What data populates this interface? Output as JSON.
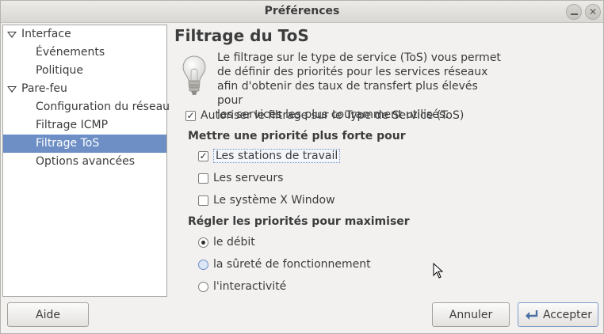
{
  "window": {
    "title": "Préférences"
  },
  "sidebar": {
    "items": [
      {
        "label": "Interface",
        "level": 0,
        "expanded": true
      },
      {
        "label": "Événements",
        "level": 1
      },
      {
        "label": "Politique",
        "level": 1
      },
      {
        "label": "Pare-feu",
        "level": 0,
        "expanded": true
      },
      {
        "label": "Configuration du réseau",
        "level": 1
      },
      {
        "label": "Filtrage ICMP",
        "level": 1
      },
      {
        "label": "Filtrage ToS",
        "level": 1,
        "selected": true
      },
      {
        "label": "Options avancées",
        "level": 1
      }
    ]
  },
  "main": {
    "title": "Filtrage du ToS",
    "icon": "lightbulb-icon",
    "description_lines": [
      "Le filtrage sur le type de service (ToS) vous permet",
      "de définir des priorités pour les services réseaux",
      "afin d'obtenir des taux de transfert plus élevés pour",
      "les services les plus couramment utilisés."
    ],
    "enable_checkbox": {
      "label": "Autoriser le filtrage sur le Type de Service (ToS)",
      "checked": true
    },
    "priority_section": {
      "title": "Mettre une priorité plus forte pour",
      "options": [
        {
          "label": "Les stations de travail",
          "checked": true
        },
        {
          "label": "Les serveurs",
          "checked": false
        },
        {
          "label": "Le système X Window",
          "checked": false
        }
      ]
    },
    "maximize_section": {
      "title": "Régler les priorités pour maximiser",
      "options": [
        {
          "label": "le débit",
          "selected": true
        },
        {
          "label": "la sûreté de fonctionnement",
          "selected": false
        },
        {
          "label": "l'interactivité",
          "selected": false
        }
      ]
    }
  },
  "buttons": {
    "help": "Aide",
    "cancel": "Annuler",
    "accept": "Accepter"
  },
  "colors": {
    "selection": "#6d8fc5",
    "window_bg": "#f2f1f0"
  }
}
